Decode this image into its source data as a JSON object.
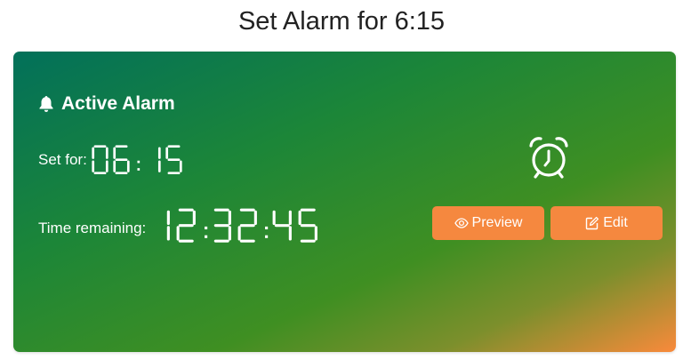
{
  "page": {
    "title": "Set Alarm for 6:15"
  },
  "card": {
    "heading": "Active Alarm",
    "set_for_label": "Set for:",
    "set_for_value": "06:15",
    "remaining_label": "Time remaining:",
    "remaining_value": "12:32:45",
    "icons": {
      "heading": "bell-icon",
      "main": "alarm-clock-icon",
      "preview": "eye-icon",
      "edit": "edit-icon"
    }
  },
  "buttons": {
    "preview_label": "Preview",
    "edit_label": "Edit"
  },
  "colors": {
    "gradient_start": "#02705a",
    "gradient_mid": "#3c8f24",
    "gradient_end": "#f78a3c",
    "button": "#f5883f",
    "text": "#ffffff"
  }
}
